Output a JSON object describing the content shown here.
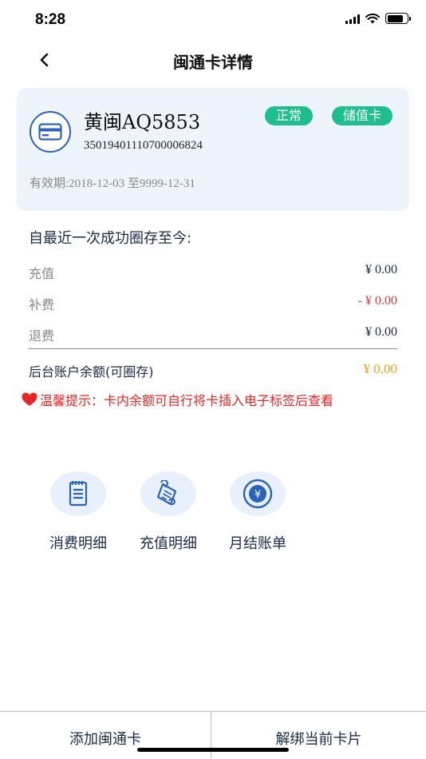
{
  "status_bar": {
    "time": "8:28"
  },
  "nav": {
    "title": "闽通卡详情"
  },
  "card": {
    "name": "黄闽AQ5853",
    "number": "35019401110700006824",
    "status_badge": "正常",
    "type_badge": "储值卡",
    "validity": "有效期:2018-12-03 至9999-12-31",
    "colors": {
      "badge": "#1ebf8c",
      "icon_stroke": "#2c63b8"
    }
  },
  "summary": {
    "title": "自最近一次成功圈存至今:",
    "rows": [
      {
        "label": "充值",
        "value": "¥ 0.00"
      },
      {
        "label": "补费",
        "value": "- ¥ 0.00"
      },
      {
        "label": "退费",
        "value": "¥ 0.00"
      }
    ],
    "balance": {
      "label": "后台账户余额(可圈存)",
      "value": "¥ 0.00"
    }
  },
  "tip": {
    "text": "温馨提示：卡内余额可自行将卡插入电子标签后查看",
    "icon": "heart-icon"
  },
  "actions": [
    {
      "label": "消费明细",
      "icon": "receipt-icon"
    },
    {
      "label": "充值明细",
      "icon": "scroll-icon"
    },
    {
      "label": "月结账单",
      "icon": "yen-coin-icon"
    }
  ],
  "bottom": {
    "add_label": "添加闽通卡",
    "unbind_label": "解绑当前卡片"
  },
  "colors": {
    "accent_blue": "#2c63b8",
    "negative": "#e03b3b",
    "balance": "#f0a020",
    "tip": "#e32626"
  }
}
